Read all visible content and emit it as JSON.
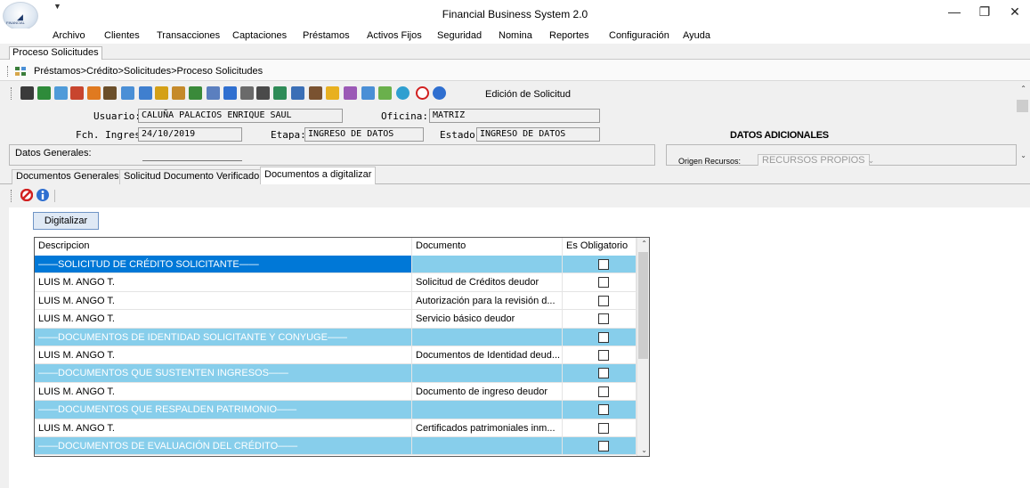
{
  "window": {
    "title": "Financial Business System 2.0",
    "logo_text": "FINANCIAL",
    "controls": {
      "minimize": "—",
      "restore": "❐",
      "close": "✕"
    }
  },
  "menu": {
    "items": [
      "Archivo",
      "Clientes",
      "Transacciones",
      "Captaciones",
      "Préstamos",
      "Activos Fijos",
      "Seguridad",
      "Nomina",
      "Reportes",
      "Configuración",
      "Ayuda"
    ]
  },
  "doc_tab": "Proceso Solicitudes",
  "breadcrumb": "Préstamos>Crédito>Solicitudes>Proceso Solicitudes",
  "toolbar": {
    "label": "Edición de Solicitud",
    "icons": [
      "list-icon",
      "green-book-icon",
      "chart-doc-icon",
      "users-icon",
      "home-icon",
      "tools-icon",
      "doc-arrow-icon",
      "doc-edit-icon",
      "pencil-icon",
      "printer-icon",
      "tree-icon",
      "table-icon",
      "edit-icon",
      "stack-icon",
      "print-icon",
      "doc-check-icon",
      "book-icon",
      "doc-user-icon",
      "group-icon",
      "wand-icon",
      "export-icon",
      "report-icon",
      "globe-icon",
      "cancel-icon",
      "info-icon"
    ]
  },
  "form": {
    "usuario_label": "Usuario:",
    "usuario_value": "CALUÑA PALACIOS ENRIQUE SAUL",
    "oficina_label": "Oficina:",
    "oficina_value": "MATRIZ",
    "fch_label": "Fch. Ingreso:",
    "fch_value": "24/10/2019",
    "etapa_label": "Etapa:",
    "etapa_value": "INGRESO DE DATOS",
    "estado_label": "Estado:",
    "estado_value": "INGRESO DE DATOS"
  },
  "datos_adicionales": "DATOS ADICIONALES",
  "datos_generales": "Datos Generales:",
  "origen": {
    "label": "Origen Recursos:",
    "value": "RECURSOS PROPIOS"
  },
  "tabs": [
    "Documentos Generales",
    "Solicitud Documento Verificado",
    "Documentos a digitalizar"
  ],
  "digitalizar": "Digitalizar",
  "grid": {
    "headers": [
      "Descripcion",
      "Documento",
      "Es Obligatorio"
    ],
    "rows": [
      {
        "desc": "——SOLICITUD DE CRÉDITO SOLICITANTE——",
        "doc": "",
        "group": true,
        "selected": true
      },
      {
        "desc": "LUIS M. ANGO T.",
        "doc": "Solicitud de Créditos deudor",
        "group": false
      },
      {
        "desc": "LUIS M. ANGO T.",
        "doc": "Autorización para la revisión d...",
        "group": false
      },
      {
        "desc": "LUIS M. ANGO T.",
        "doc": "Servicio básico deudor",
        "group": false
      },
      {
        "desc": "——DOCUMENTOS DE IDENTIDAD SOLICITANTE Y CONYUGE——",
        "doc": "",
        "group": true
      },
      {
        "desc": "LUIS M. ANGO T.",
        "doc": "Documentos de Identidad deud...",
        "group": false
      },
      {
        "desc": "——DOCUMENTOS QUE SUSTENTEN INGRESOS——",
        "doc": "",
        "group": true
      },
      {
        "desc": "LUIS M. ANGO T.",
        "doc": "Documento de ingreso deudor",
        "group": false
      },
      {
        "desc": "——DOCUMENTOS QUE RESPALDEN PATRIMONIO——",
        "doc": "",
        "group": true
      },
      {
        "desc": "LUIS M. ANGO T.",
        "doc": "Certificados patrimoniales inm...",
        "group": false
      },
      {
        "desc": "——DOCUMENTOS DE EVALUACIÓN DEL CRÉDITO——",
        "doc": "",
        "group": true
      }
    ]
  },
  "colors": {
    "group_row": "#87ceeb",
    "selected_row": "#0078d7"
  }
}
